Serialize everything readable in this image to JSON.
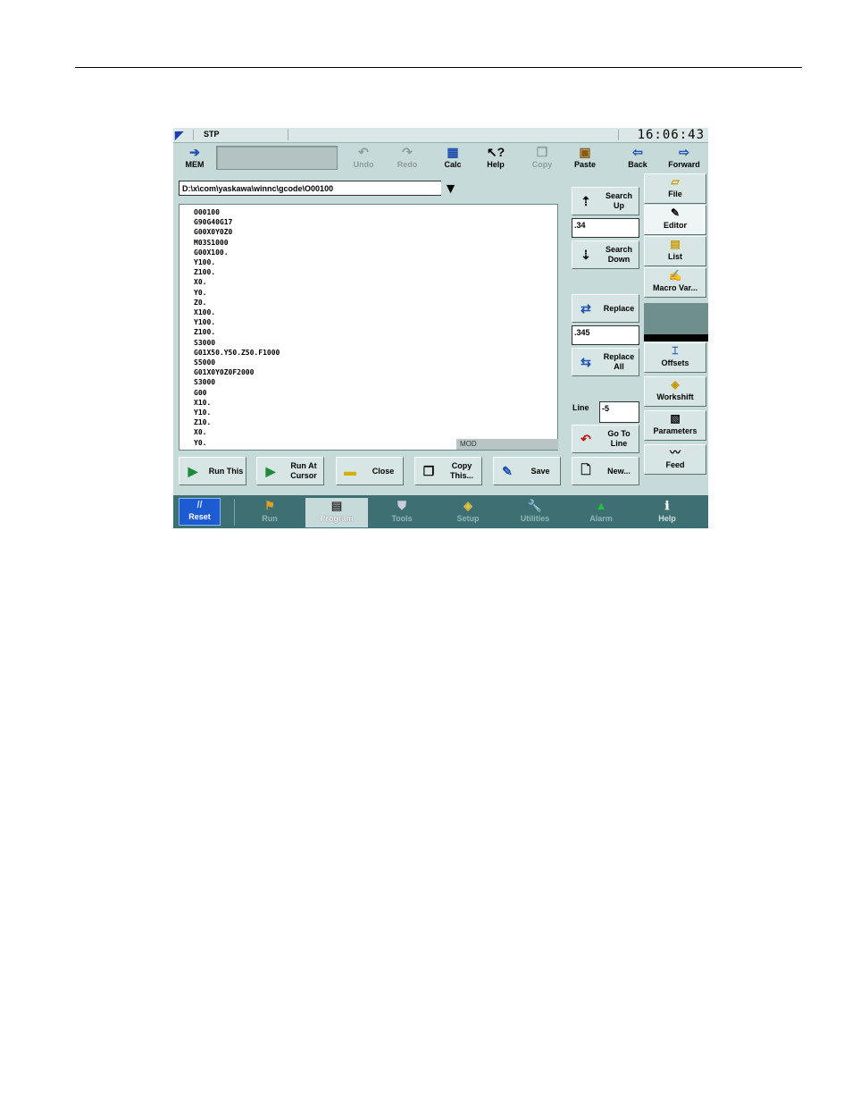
{
  "status": {
    "mode": "STP",
    "clock": "16:06:43"
  },
  "toolbar": {
    "mem": "MEM",
    "undo": "Undo",
    "redo": "Redo",
    "calc": "Calc",
    "help": "Help",
    "copy": "Copy",
    "paste": "Paste",
    "back": "Back",
    "forward": "Forward"
  },
  "file_path": "D:\\x\\com\\yaskawa\\winnc\\gcode\\O00100",
  "editor": {
    "lines": [
      "O00100",
      "G90G40G17",
      "G00X0Y0Z0",
      "M03S1000",
      "G00X100.",
      "Y100.",
      "Z100.",
      "X0.",
      "Y0.",
      "Z0.",
      "X100.",
      "Y100.",
      "Z100.",
      "S3000",
      "G01X50.Y50.Z50.F1000",
      "S5000",
      "G01X0Y0Z0F2000",
      "S3000",
      "G00",
      "X10.",
      "Y10.",
      "Z10.",
      "X0.",
      "Y0."
    ],
    "mode_label": "MOD"
  },
  "search": {
    "search_up": "Search Up",
    "search_value": ".34",
    "search_down": "Search Down",
    "replace": "Replace",
    "replace_value": ".345",
    "replace_all": "Replace All",
    "line_label": "Line",
    "line_value": "-5",
    "go_to_line": "Go To Line",
    "new": "New..."
  },
  "bottom_buttons": {
    "run_this": "Run This",
    "run_at_cursor": "Run At Cursor",
    "close": "Close",
    "copy_this": "Copy This...",
    "save": "Save"
  },
  "sidebar": {
    "file": "File",
    "editor": "Editor",
    "list": "List",
    "macro_var": "Macro Var...",
    "offsets": "Offsets",
    "workshift": "Workshift",
    "parameters": "Parameters",
    "feed": "Feed"
  },
  "nav": {
    "reset": "Reset",
    "run": "Run",
    "program": "Program",
    "tools": "Tools",
    "setup": "Setup",
    "utilities": "Utilities",
    "alarm": "Alarm",
    "help": "Help"
  }
}
